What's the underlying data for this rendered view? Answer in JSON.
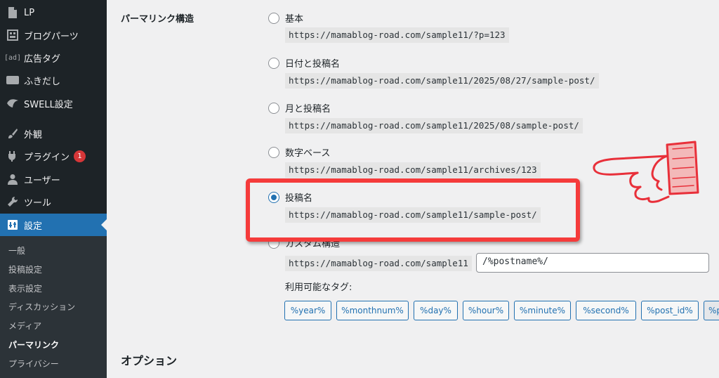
{
  "sidebar": {
    "items": [
      {
        "label": "LP",
        "icon": "page-icon"
      },
      {
        "label": "ブログパーツ",
        "icon": "blocks-icon"
      },
      {
        "label": "広告タグ",
        "icon": "ad-icon",
        "icon_text": "[ad]"
      },
      {
        "label": "ふきだし",
        "icon": "speech-bubble-icon"
      },
      {
        "label": "SWELL設定",
        "icon": "swell-icon"
      },
      {
        "label": "外観",
        "icon": "brush-icon"
      },
      {
        "label": "プラグイン",
        "icon": "plugin-icon",
        "badge": "1"
      },
      {
        "label": "ユーザー",
        "icon": "user-icon"
      },
      {
        "label": "ツール",
        "icon": "wrench-icon"
      },
      {
        "label": "設定",
        "icon": "settings-icon"
      }
    ],
    "submenu": [
      "一般",
      "投稿設定",
      "表示設定",
      "ディスカッション",
      "メディア",
      "パーマリンク",
      "プライバシー"
    ],
    "current_submenu": "パーマリンク"
  },
  "permalink": {
    "label": "パーマリンク構造",
    "options": [
      {
        "label": "基本",
        "url": "https://mamablog-road.com/sample11/?p=123",
        "checked": false
      },
      {
        "label": "日付と投稿名",
        "url": "https://mamablog-road.com/sample11/2025/08/27/sample-post/",
        "checked": false
      },
      {
        "label": "月と投稿名",
        "url": "https://mamablog-road.com/sample11/2025/08/sample-post/",
        "checked": false
      },
      {
        "label": "数字ベース",
        "url": "https://mamablog-road.com/sample11/archives/123",
        "checked": false
      },
      {
        "label": "投稿名",
        "url": "https://mamablog-road.com/sample11/sample-post/",
        "checked": true
      }
    ],
    "custom": {
      "label": "カスタム構造",
      "prefix": "https://mamablog-road.com/sample11",
      "value": "/%postname%/"
    },
    "tags_label": "利用可能なタグ:",
    "tags": [
      "%year%",
      "%monthnum%",
      "%day%",
      "%hour%",
      "%minute%",
      "%second%",
      "%post_id%",
      "%p"
    ]
  },
  "options_title": "オプション",
  "colors": {
    "admin_bar": "#1d2327",
    "accent": "#2271b1",
    "highlight": "#f53b3b",
    "badge": "#d63638"
  }
}
